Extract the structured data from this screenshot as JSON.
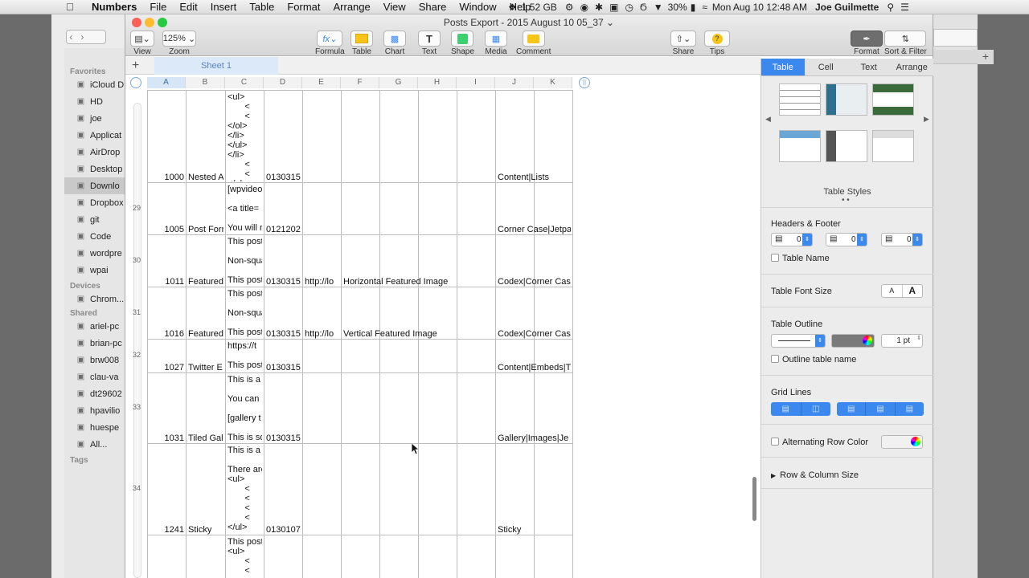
{
  "menubar": {
    "app": "Numbers",
    "items": [
      "File",
      "Edit",
      "Insert",
      "Table",
      "Format",
      "Arrange",
      "View",
      "Share",
      "Window",
      "Help"
    ],
    "memory": "1.52 GB",
    "battery": "30%",
    "datetime": "Mon Aug 10  12:48 AM",
    "user": "Joe Guilmette"
  },
  "finder": {
    "favorites_header": "Favorites",
    "favorites": [
      {
        "label": "iCloud D",
        "icon": "cloud-icon"
      },
      {
        "label": "HD",
        "icon": "disk-icon"
      },
      {
        "label": "joe",
        "icon": "home-icon"
      },
      {
        "label": "Applicat",
        "icon": "app-icon"
      },
      {
        "label": "AirDrop",
        "icon": "airdrop-icon"
      },
      {
        "label": "Desktop",
        "icon": "desktop-icon"
      },
      {
        "label": "Downlo",
        "icon": "download-icon"
      },
      {
        "label": "Dropbox",
        "icon": "dropbox-icon"
      },
      {
        "label": "git",
        "icon": "folder-icon"
      },
      {
        "label": "Code",
        "icon": "folder-icon"
      },
      {
        "label": "wordpre",
        "icon": "folder-icon"
      },
      {
        "label": "wpai",
        "icon": "folder-icon"
      }
    ],
    "devices_header": "Devices",
    "devices": [
      {
        "label": "Chrom...",
        "icon": "disk-icon"
      }
    ],
    "shared_header": "Shared",
    "shared": [
      {
        "label": "ariel-pc",
        "icon": "monitor-icon"
      },
      {
        "label": "brian-pc",
        "icon": "monitor-icon"
      },
      {
        "label": "brw008",
        "icon": "monitor-icon"
      },
      {
        "label": "clau-va",
        "icon": "monitor-icon"
      },
      {
        "label": "dt29602",
        "icon": "monitor-icon"
      },
      {
        "label": "hpavilio",
        "icon": "monitor-icon"
      },
      {
        "label": "huespe",
        "icon": "monitor-icon"
      },
      {
        "label": "All...",
        "icon": "globe-icon"
      }
    ],
    "tags_header": "Tags"
  },
  "window": {
    "title": "Posts Export - 2015 August 10 05_37",
    "sheet_tab": "Sheet 1"
  },
  "toolbar": {
    "view": "View",
    "zoom_value": "125%",
    "zoom": "Zoom",
    "formula": "Formula",
    "table": "Table",
    "chart": "Chart",
    "text": "Text",
    "shape": "Shape",
    "media": "Media",
    "comment": "Comment",
    "share": "Share",
    "tips": "Tips",
    "format": "Format",
    "sort_filter": "Sort & Filter"
  },
  "columns": [
    "A",
    "B",
    "C",
    "D",
    "E",
    "F",
    "G",
    "H",
    "I",
    "J",
    "K"
  ],
  "rows": [
    {
      "num": "",
      "id": "1000",
      "title": "Nested A",
      "content": "<ul>\n       <\n       <\n</ol>\n</li>\n</ul>\n</li>\n       <\n       <\n</ul>",
      "date": "0130315",
      "link": "",
      "excerpt": "",
      "tags": "Content|Lists"
    },
    {
      "num": "29",
      "id": "1005",
      "title": "Post Forn",
      "content": "[wpvideo\n\n<a title=\n\nYou will r",
      "date": "0121202",
      "link": "",
      "excerpt": "",
      "tags": "Corner Case|Jetpa"
    },
    {
      "num": "30",
      "id": "1011",
      "title": "Featured",
      "content": "This post\n\nNon-squa\n\nThis post",
      "date": "0130315",
      "link": "http://lo",
      "excerpt": "Horizontal Featured Image",
      "tags": "Codex|Corner Case"
    },
    {
      "num": "31",
      "id": "1016",
      "title": "Featured",
      "content": "This post\n\nNon-squa\n\nThis post",
      "date": "0130315",
      "link": "http://lo",
      "excerpt": "Vertical Featured Image",
      "tags": "Codex|Corner Case"
    },
    {
      "num": "32",
      "id": "1027",
      "title": "Twitter E",
      "content": "https://t\n\nThis post",
      "date": "0130315",
      "link": "",
      "excerpt": "",
      "tags": "Content|Embeds|T"
    },
    {
      "num": "33",
      "id": "1031",
      "title": "Tiled Gall",
      "content": "This is a\n\nYou can i\n\n[gallery t\n\nThis is so",
      "date": "0130315",
      "link": "",
      "excerpt": "",
      "tags": "Gallery|Images|Je"
    },
    {
      "num": "34",
      "id": "1241",
      "title": "Sticky",
      "content": "This is a\n\nThere are\n<ul>\n       <\n       <\n       <\n       <\n</ul>",
      "date": "0130107",
      "link": "",
      "excerpt": "",
      "tags": "Sticky"
    },
    {
      "num": "",
      "id": "",
      "title": "",
      "content": "This post\n<ul>\n       <\n       <",
      "date": "",
      "link": "",
      "excerpt": "",
      "tags": ""
    }
  ],
  "inspector": {
    "tabs": [
      "Table",
      "Cell",
      "Text",
      "Arrange"
    ],
    "table_styles": "Table Styles",
    "headers_footer": "Headers & Footer",
    "header_rows": "0",
    "header_cols": "0",
    "footer_rows": "0",
    "table_name": "Table Name",
    "font_size": "Table Font Size",
    "font_small": "A",
    "font_large": "A",
    "outline": "Table Outline",
    "outline_width": "1 pt",
    "outline_name": "Outline table name",
    "grid_lines": "Grid Lines",
    "alt_row": "Alternating Row Color",
    "row_col_size": "Row & Column Size"
  }
}
